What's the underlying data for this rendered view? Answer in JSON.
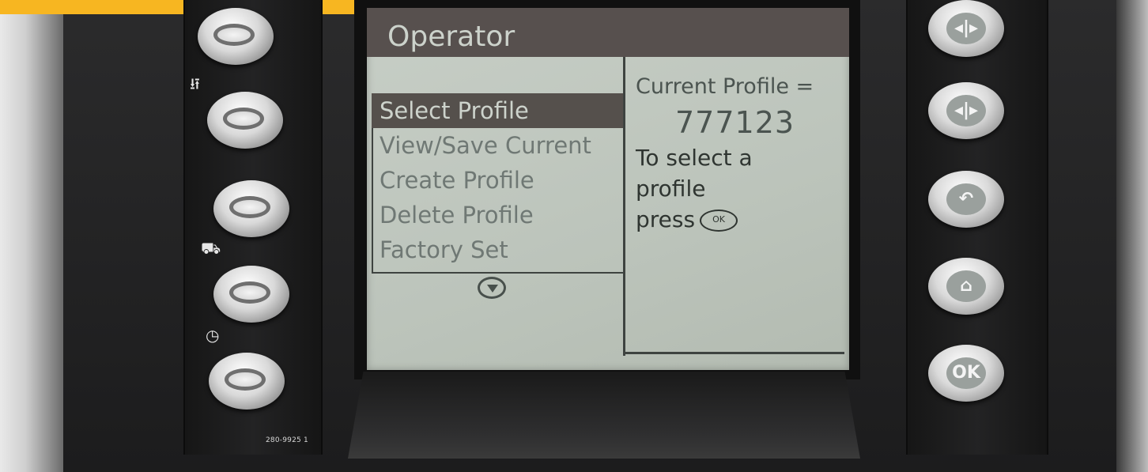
{
  "screen": {
    "title": "Operator",
    "menu": {
      "items": [
        {
          "label": "Select Profile",
          "selected": true
        },
        {
          "label": "View/Save Current",
          "selected": false
        },
        {
          "label": "Create Profile",
          "selected": false
        },
        {
          "label": "Delete Profile",
          "selected": false
        },
        {
          "label": "Factory Set",
          "selected": false
        }
      ],
      "scroll_icon": "arrow-down-circle-icon"
    },
    "info": {
      "current_profile_label": "Current Profile =",
      "current_profile_value": "777123",
      "instruction_line1": "To select a",
      "instruction_line2": "profile",
      "instruction_line3": "press",
      "ok_glyph": "OK"
    }
  },
  "left_panel": {
    "icons": [
      "usb-icon",
      "work-tool-icon",
      "clock-icon"
    ],
    "part_number": "280-9925 1"
  },
  "right_panel": {
    "buttons": [
      {
        "icon": "left-right-arrows-icon",
        "glyph": "◂|▸"
      },
      {
        "icon": "left-right-arrows-icon",
        "glyph": "◂|▸"
      },
      {
        "icon": "back-icon",
        "glyph": "↶"
      },
      {
        "icon": "home-icon",
        "glyph": "⌂"
      },
      {
        "icon": "ok-icon",
        "glyph": "OK"
      }
    ]
  },
  "colors": {
    "highlight_bar": "#f7b621",
    "lcd_background": "#c4cbc3",
    "lcd_title_bar": "#57504e",
    "lcd_selection": "#55504c"
  }
}
